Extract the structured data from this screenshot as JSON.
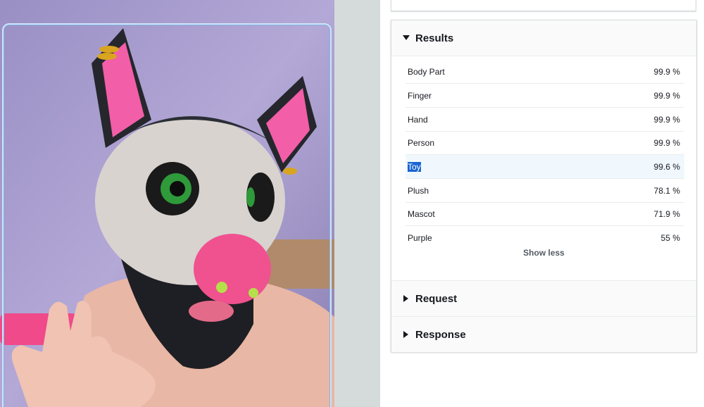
{
  "results": {
    "title": "Results",
    "labels": [
      {
        "name": "Body Part",
        "confidence": "99.9 %"
      },
      {
        "name": "Finger",
        "confidence": "99.9 %"
      },
      {
        "name": "Hand",
        "confidence": "99.9 %"
      },
      {
        "name": "Person",
        "confidence": "99.9 %"
      },
      {
        "name": "Toy",
        "confidence": "99.6 %"
      },
      {
        "name": "Plush",
        "confidence": "78.1 %"
      },
      {
        "name": "Mascot",
        "confidence": "71.9 %"
      },
      {
        "name": "Purple",
        "confidence": "55 %"
      }
    ],
    "show_less": "Show less"
  },
  "request": {
    "title": "Request"
  },
  "response": {
    "title": "Response"
  },
  "colors": {
    "highlight_row": "#f1f8fd",
    "selection": "#1a64d2",
    "gutter": "#d5dbdb"
  },
  "icons": {
    "expanded": "caret-down-icon",
    "collapsed": "caret-right-icon"
  }
}
